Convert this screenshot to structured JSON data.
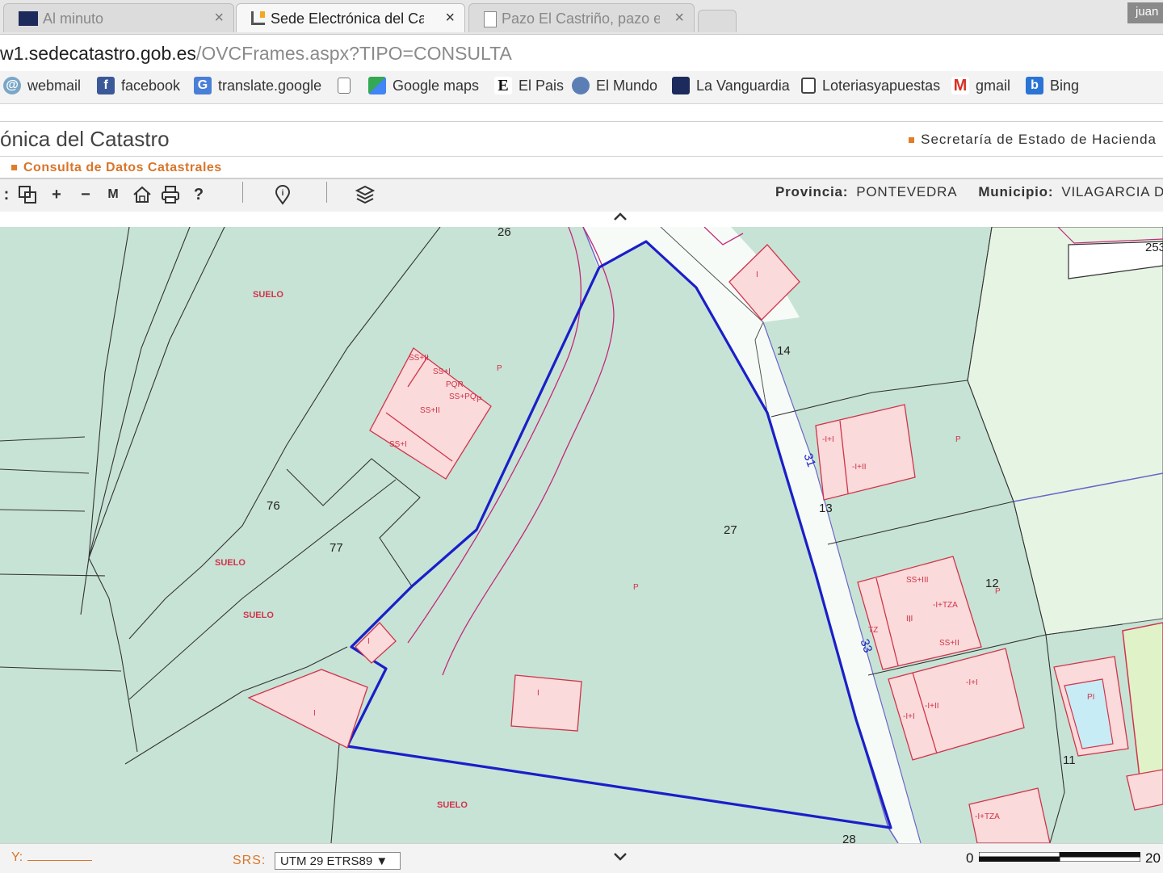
{
  "tabs": [
    {
      "label": "Al minuto",
      "close": "×",
      "active": false
    },
    {
      "label": "Sede Electrónica del Cata:",
      "close": "×",
      "active": true
    },
    {
      "label": "Pazo El Castriño, pazo en",
      "close": "×",
      "active": false
    }
  ],
  "profile": {
    "label": "juan"
  },
  "address": {
    "host": "w1.sedecatastro.gob.es",
    "path": "/OVCFrames.aspx?TIPO=CONSULTA"
  },
  "bookmarks": [
    {
      "label": "webmail",
      "icon": "webmail-icon"
    },
    {
      "label": "facebook",
      "icon": "facebook-icon"
    },
    {
      "label": "translate.google",
      "icon": "translate-icon"
    },
    {
      "label": "",
      "icon": "page-icon"
    },
    {
      "label": "Google maps",
      "icon": "maps-icon"
    },
    {
      "label": "El Pais",
      "icon": "elpais-icon"
    },
    {
      "label": "El Mundo",
      "icon": "globe-icon"
    },
    {
      "label": "La Vanguardia",
      "icon": "vanguardia-icon"
    },
    {
      "label": "Loteriasyapuestas",
      "icon": "lottery-icon"
    },
    {
      "label": "gmail",
      "icon": "gmail-icon"
    },
    {
      "label": "Bing",
      "icon": "bing-icon"
    }
  ],
  "header": {
    "title": "ónica del Catastro",
    "ministry": "Secretaría de Estado de Hacienda"
  },
  "section": {
    "title": "Consulta de Datos Catastrales"
  },
  "toolbar": {
    "tools": [
      "zoom-box-icon",
      "zoom-in-icon",
      "zoom-out-icon",
      "measure-icon",
      "home-icon",
      "print-icon",
      "help-icon",
      "info-pin-icon",
      "layers-icon"
    ],
    "zoom_in": "+",
    "zoom_out": "−",
    "measure": "M",
    "help": "?"
  },
  "location": {
    "province_label": "Provincia:",
    "province": "PONTEVEDRA",
    "municipality_label": "Municipio:",
    "municipality": "VILAGARCIA DE"
  },
  "map": {
    "parcel_numbers": [
      "26",
      "14",
      "76",
      "77",
      "31",
      "13",
      "27",
      "12",
      "33",
      "11",
      "28",
      "253"
    ],
    "land_labels": [
      "SUELO",
      "SUELO",
      "SUELO",
      "SUELO"
    ],
    "building_codes": [
      "SS+II",
      "SS+I",
      "PQR",
      "SS+PQ",
      "SS+II",
      "SS+I",
      "P",
      "P",
      "-I+I",
      "-I+II",
      "P",
      "P",
      "SS+III",
      "-I+TZA",
      "III",
      "TZ",
      "SS+II",
      "-I+I",
      "-I+II",
      "-I+I",
      "PI",
      "P",
      "-I+TZA",
      "I",
      "I",
      "I",
      "I",
      "I"
    ],
    "colors": {
      "parcel_fill": "#c7e3d6",
      "building_fill": "#fadada",
      "building_stroke": "#d0344a",
      "selected_boundary": "#1a1fc8",
      "road_edge": "#6a66c8",
      "light_parcel": "#e6f4e4"
    }
  },
  "footer": {
    "y_label": "Y:",
    "srs_label": "SRS:",
    "srs_value": "UTM 29 ETRS89 ▼",
    "scale_start": "0",
    "scale_end": "20"
  }
}
